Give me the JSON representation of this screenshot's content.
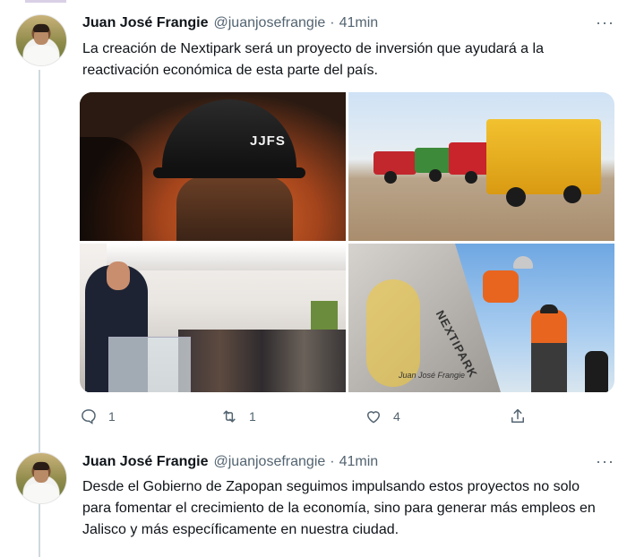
{
  "tweets": [
    {
      "name": "Juan José Frangie",
      "handle": "@juanjosefrangie",
      "separator": "·",
      "time": "41min",
      "more": "···",
      "text": "La creación de Nextipark será un proyecto de inversión que ayudará a la reactivación económica de esta parte del país.",
      "media": {
        "helmet_label": "JJFS",
        "plaque_label": "NEXTIPARK",
        "plaque_caption": "Juan José Frangie"
      },
      "actions": {
        "reply_count": "1",
        "retweet_count": "1",
        "like_count": "4",
        "share_count": ""
      }
    },
    {
      "name": "Juan José Frangie",
      "handle": "@juanjosefrangie",
      "separator": "·",
      "time": "41min",
      "more": "···",
      "text": "Desde el Gobierno de Zapopan seguimos impulsando estos proyectos no solo para fomentar el crecimiento de la economía, sino para generar más empleos en Jalisco y más específicamente en nuestra ciudad."
    }
  ],
  "colors": {
    "text_primary": "#0f1419",
    "text_secondary": "#536471",
    "thread_line": "#cfd9de"
  }
}
